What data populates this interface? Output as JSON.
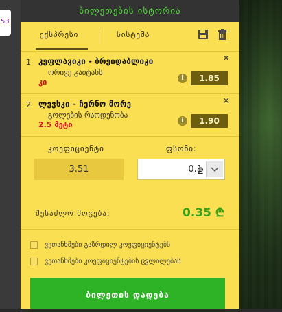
{
  "side_badge": "53",
  "header": {
    "title": "ბილეთების ისტორია"
  },
  "tabs": [
    {
      "label": "ექსპრესი",
      "active": true
    },
    {
      "label": "სისტემა",
      "active": false
    }
  ],
  "toolbar": {
    "save_icon": "save-icon",
    "delete_icon": "trash-icon"
  },
  "bets": [
    {
      "num": "1",
      "event": "კეფლავიკი - ბრეიდაბლიკი",
      "market": "ორივე გაიტანს",
      "selection": "კი",
      "odds": "1.85"
    },
    {
      "num": "2",
      "event": "ლევსკი - ჩერნო მორე",
      "market": "გოლების რაოდენობა",
      "selection": "2.5 მეტი",
      "odds": "1.90"
    }
  ],
  "coefficient": {
    "label": "კოეფიციენტი",
    "value": "3.51"
  },
  "stake": {
    "label": "ფსონი:",
    "value": "0.1",
    "currency": "₾"
  },
  "winnings": {
    "label": "შესაძლო მოგება:",
    "value": "0.35 ₾"
  },
  "options": [
    "ვეთანხმები გაზრდილ კოეფიციენტებს",
    "ვეთანხმები კოეფიციენტების ცვლილებას"
  ],
  "place_bet_label": "ბილეთის დადება",
  "colors": {
    "panel": "#fbdf52",
    "title": "#48d62e",
    "odds_bg": "#6c5d0f",
    "win": "#35a31c",
    "button": "#2db325",
    "selection": "#d0111b"
  }
}
